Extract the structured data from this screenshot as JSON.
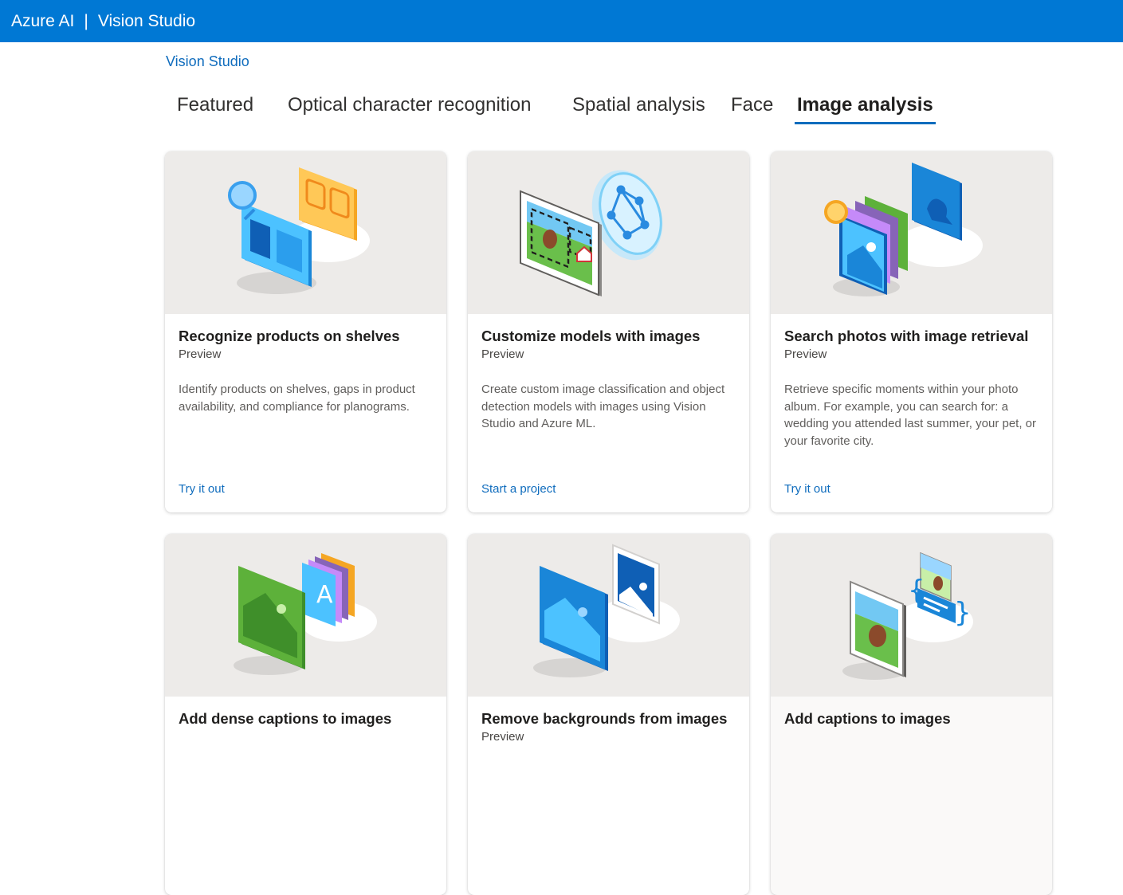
{
  "header": {
    "brand": "Azure AI",
    "separator": "|",
    "product": "Vision Studio",
    "bg_color": "#0078d4"
  },
  "breadcrumb": {
    "label": "Vision Studio"
  },
  "tabs": [
    {
      "label": "Featured",
      "active": false
    },
    {
      "label": "Optical character recognition",
      "active": false
    },
    {
      "label": "Spatial analysis",
      "active": false
    },
    {
      "label": "Face",
      "active": false
    },
    {
      "label": "Image analysis",
      "active": true
    }
  ],
  "accent_color": "#0f6cbd",
  "cards": [
    {
      "title": "Recognize products on shelves",
      "badge": "Preview",
      "description": "Identify products on shelves, gaps in product availability, and compliance for planograms.",
      "action": "Try it out",
      "icon": "product-recognition-illustration"
    },
    {
      "title": "Customize models with images",
      "badge": "Preview",
      "description": "Create custom image classification and object detection models with images using Vision Studio and Azure ML.",
      "action": "Start a project",
      "icon": "custom-model-illustration"
    },
    {
      "title": "Search photos with image retrieval",
      "badge": "Preview",
      "description": "Retrieve specific moments within your photo album. For example, you can search for: a wedding you attended last summer, your pet, or your favorite city.",
      "action": "Try it out",
      "icon": "image-retrieval-illustration"
    },
    {
      "title": "Add dense captions to images",
      "badge": "",
      "description": "",
      "action": "",
      "icon": "dense-captions-illustration"
    },
    {
      "title": "Remove backgrounds from images",
      "badge": "Preview",
      "description": "",
      "action": "",
      "icon": "background-removal-illustration"
    },
    {
      "title": "Add captions to images",
      "badge": "",
      "description": "",
      "action": "",
      "icon": "captions-illustration"
    }
  ]
}
